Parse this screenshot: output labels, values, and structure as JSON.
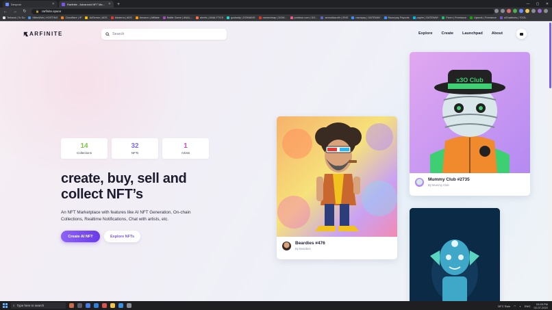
{
  "browser": {
    "tabs": [
      {
        "title": "Devpost",
        "active": false
      },
      {
        "title": "Rarfinite - Advanced NFT Marke",
        "active": true
      }
    ],
    "new_tab": "+",
    "url": "rarfinite.space",
    "bookmarks": [
      {
        "label": "Terbank | To Do",
        "color": "#e0e0e0"
      },
      {
        "label": "MilesWeb | HOSTING",
        "color": "#4a90e2"
      },
      {
        "label": "Cloudflare | IP",
        "color": "#f38020"
      },
      {
        "label": "AdSense | ADS",
        "color": "#fbbc04"
      },
      {
        "label": "Adsterra | ADS",
        "color": "#e53935"
      },
      {
        "label": "Amazon | Affiliate",
        "color": "#ff9900"
      },
      {
        "label": "Battle Game | ANAL...",
        "color": "#ab47bc"
      },
      {
        "label": "ahrefs | ANALYTICS",
        "color": "#ff7043"
      },
      {
        "label": "godaddy | DOMAINS",
        "color": "#1bdbdb"
      },
      {
        "label": "namecheap | DOM...",
        "color": "#de3723"
      },
      {
        "label": "porkbun.com | DO...",
        "color": "#ef5b8b"
      },
      {
        "label": "anmoldua.eth | ENS",
        "color": "#5c6bc0"
      },
      {
        "label": "razorpay | GATEWAY",
        "color": "#3395ff"
      },
      {
        "label": "Razorpay Payouts",
        "color": "#3395ff"
      },
      {
        "label": "paytm | GATEWAY",
        "color": "#00baf2"
      },
      {
        "label": "Fiverr | Freelance",
        "color": "#1dbf73"
      },
      {
        "label": "Upwork | Freelance",
        "color": "#14a800"
      },
      {
        "label": "uiGradients | TOOL",
        "color": "#7e57c2"
      }
    ]
  },
  "site": {
    "logo": "ARFINITE",
    "search_placeholder": "Search",
    "nav": [
      "Explore",
      "Create",
      "Launchpad",
      "About"
    ],
    "stats": [
      {
        "value": "14",
        "label": "Collections",
        "color": "#7cc44a"
      },
      {
        "value": "32",
        "label": "NFTs",
        "color": "#7b6cf0"
      },
      {
        "value": "1",
        "label": "Artists",
        "color": "#d14ab8"
      }
    ],
    "hero_line1": "create, buy, sell and",
    "hero_line2": "collect NFT’s",
    "description": "An NFT Marketplace with features like AI NFT Generation, On-chain Collections, Realtime Notifications, Chat with artists, etc.",
    "primary_button": "Create AI NFT",
    "secondary_button": "Explore NFTs",
    "cards": [
      {
        "name": "Beardies #476",
        "by": "By Beardies",
        "hat_text": ""
      },
      {
        "name": "Mummy Club #2735",
        "by": "By Mummy Club",
        "hat_text": "x3O Club"
      },
      {
        "name": "",
        "by": "",
        "hat_text": ""
      }
    ]
  },
  "taskbar": {
    "search": "Type here to search",
    "weather": "28°C  Rain",
    "lang": "ENG",
    "time": "03:28 PM",
    "date": "02-07-2022"
  },
  "colors": {
    "accent": "#7b55ee",
    "accent_dark": "#6a3ce8"
  }
}
